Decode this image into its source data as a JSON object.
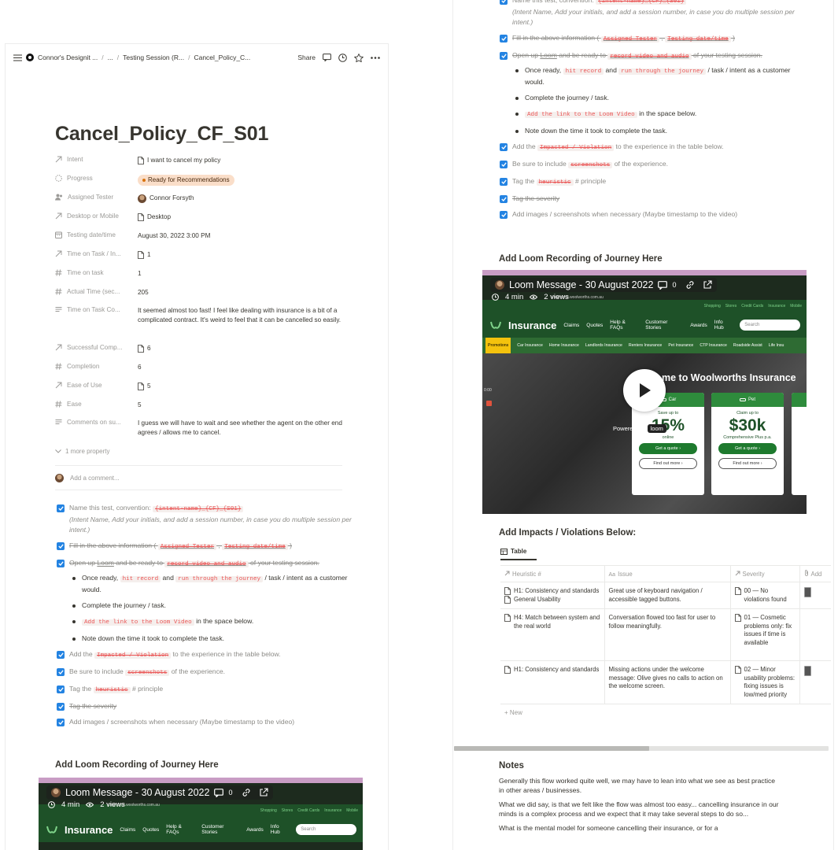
{
  "left": {
    "topbar": {
      "workspace": "Connor's Designit ...",
      "crumb_ellipsis": "...",
      "crumb_session": "Testing Session (R...",
      "crumb_page": "Cancel_Policy_C...",
      "share": "Share"
    },
    "title": "Cancel_Policy_CF_S01",
    "properties": [
      {
        "icon": "arrow-icon",
        "key": "Intent",
        "value": "I want to cancel my policy",
        "doc": true
      },
      {
        "icon": "progress-icon",
        "key": "Progress",
        "value": "Ready for Recommendations",
        "pill": true
      },
      {
        "icon": "people-icon",
        "key": "Assigned Tester",
        "value": "Connor Forsyth",
        "avatar": true
      },
      {
        "icon": "arrow-icon",
        "key": "Desktop or Mobile",
        "value": "Desktop",
        "doc": true
      },
      {
        "icon": "calendar-icon",
        "key": "Testing date/time",
        "value": "August 30, 2022 3:00 PM"
      },
      {
        "icon": "arrow-icon",
        "key": "Time on Task / In...",
        "value": "1",
        "doc": true
      },
      {
        "icon": "hash-icon",
        "key": "Time on task",
        "value": "1"
      },
      {
        "icon": "hash-icon",
        "key": "Actual Time (sec...",
        "value": "205"
      },
      {
        "icon": "text-icon",
        "key": "Time on Task Co...",
        "value": "It seemed almost too fast! I feel like dealing with insurance is a bit of a complicated contract. It's weird to feel that it can be cancelled so easily."
      },
      {
        "icon": "arrow-icon",
        "key": "Successful Comp...",
        "value": "6",
        "doc": true
      },
      {
        "icon": "hash-icon",
        "key": "Completion",
        "value": "6"
      },
      {
        "icon": "arrow-icon",
        "key": "Ease of Use",
        "value": "5",
        "doc": true
      },
      {
        "icon": "hash-icon",
        "key": "Ease",
        "value": "5"
      },
      {
        "icon": "text-icon",
        "key": "Comments on su...",
        "value": "I guess we will have to wait and see whether the agent on the other end agrees / allows me to cancel."
      }
    ],
    "more_property": "1 more property",
    "add_comment": "Add a comment..."
  },
  "checklist": {
    "item1_pre": "Name this test, convention: ",
    "item1_code": "{intent-name}_{CF}_{S01}",
    "item1_note": "(Intent Name, Add your initials, and add a session number, in case you do multiple session per intent.)",
    "item2_pre": "Fill in the above information ( ",
    "item2_code1": "Assigned Tester",
    "item2_sep": " , ",
    "item2_code2": "Testing date/time",
    "item2_post": " )",
    "item3_pre": "Open up ",
    "item3_link": "Loom",
    "item3_mid": " and be ready to ",
    "item3_code": "record video and audio",
    "item3_post": " of your testing session.",
    "b1_pre": "Once ready, ",
    "b1_code1": "hit record",
    "b1_mid": " and ",
    "b1_code2": "run through the journey",
    "b1_post": " / task / intent as a customer would.",
    "b2": "Complete the journey / task.",
    "b3_code": "Add the link to the Loom Video",
    "b3_post": " in the space below.",
    "b4": "Note down the time it took to complete the task.",
    "item4_pre": "Add the ",
    "item4_code": "Impacted / Violation",
    "item4_post": " to the experience in the table below.",
    "item5_pre": "Be sure to include ",
    "item5_code": "screenshots",
    "item5_post": " of the experience.",
    "item6_pre": "Tag the ",
    "item6_code": "heuristic",
    "item6_post": " # principle",
    "item7": "Tag the severity",
    "item8": "Add images / screenshots when necessary (Maybe timestamp to the video)"
  },
  "loom_heading": "Add Loom Recording of Journey Here",
  "video": {
    "title": "Loom Message - 30 August 2022",
    "comments": "0",
    "duration": "4 min",
    "views": "2 views",
    "site_url": "insurance.woolworths.com.au",
    "brand": "Insurance",
    "nav": [
      "Claims",
      "Quotes",
      "Help & FAQs",
      "Customer Stories",
      "Awards",
      "Info Hub"
    ],
    "search": "Search",
    "top_links": [
      "Shopping",
      "Stores",
      "Credit Cards",
      "Insurance",
      "Mobile"
    ],
    "subnav": [
      "Promotions",
      "Car Insurance",
      "Home Insurance",
      "Landlords Insurance",
      "Renters Insurance",
      "Pet Insurance",
      "CTP Insurance",
      "Roadside Assist",
      "Life Insu"
    ],
    "hero": "me to Woolworths Insurance",
    "card1": {
      "head": "Car",
      "line1": "Save up to",
      "big": "15%",
      "line2": "online",
      "btn": "Get a quote  ›",
      "btn2": "Find out more  ›"
    },
    "card2": {
      "head": "Pet",
      "line1": "Claim up to",
      "big": "$30k",
      "line2": "Comprehensive Plus p.a.",
      "btn": "Get a quote  ›",
      "btn2": "Find out more  ›"
    },
    "powered": "Powered by",
    "loom": "loom",
    "side_time": "0:00"
  },
  "impacts_heading": "Add Impacts / Violations Below:",
  "table": {
    "tab": "Table",
    "columns": [
      "Heuristic #",
      "Issue",
      "Severity",
      "Add"
    ],
    "rows": [
      {
        "heuristic": [
          "H1: Consistency and standards",
          "General Usability"
        ],
        "issue": "Great use of keyboard navigation / accessible tagged buttons.",
        "severity": "00 — No violations found",
        "thumb": true
      },
      {
        "heuristic": [
          "H4: Match between system and the real world"
        ],
        "issue": "Conversation flowed too fast for user to follow meaningfully.",
        "severity": "01 — Cosmetic problems only: fix issues if time is available",
        "thumb": false
      },
      {
        "heuristic": [
          "H1: Consistency and standards"
        ],
        "issue": "Missing actions under the welcome message: Olive gives no calls to action on the welcome screen.",
        "severity": "02 — Minor usability problems: fixing issues is low/med priority",
        "thumb": true
      }
    ],
    "new": "New"
  },
  "notes": {
    "heading": "Notes",
    "p1": "Generally this flow worked quite well, we may have to lean into what we see as best practice in other areas / businesses.",
    "p2": "What we did say, is that we felt like the flow was almost too easy... cancelling insurance in our minds is a complex process and we expect that it may take several steps to do so...",
    "p3": "What is the mental model for someone cancelling their insurance, or for a"
  },
  "colors": {
    "accent": "#2383e2",
    "code": "#eb5757",
    "pill_bg": "#fadec9",
    "woolworths_green": "#1e5128"
  }
}
